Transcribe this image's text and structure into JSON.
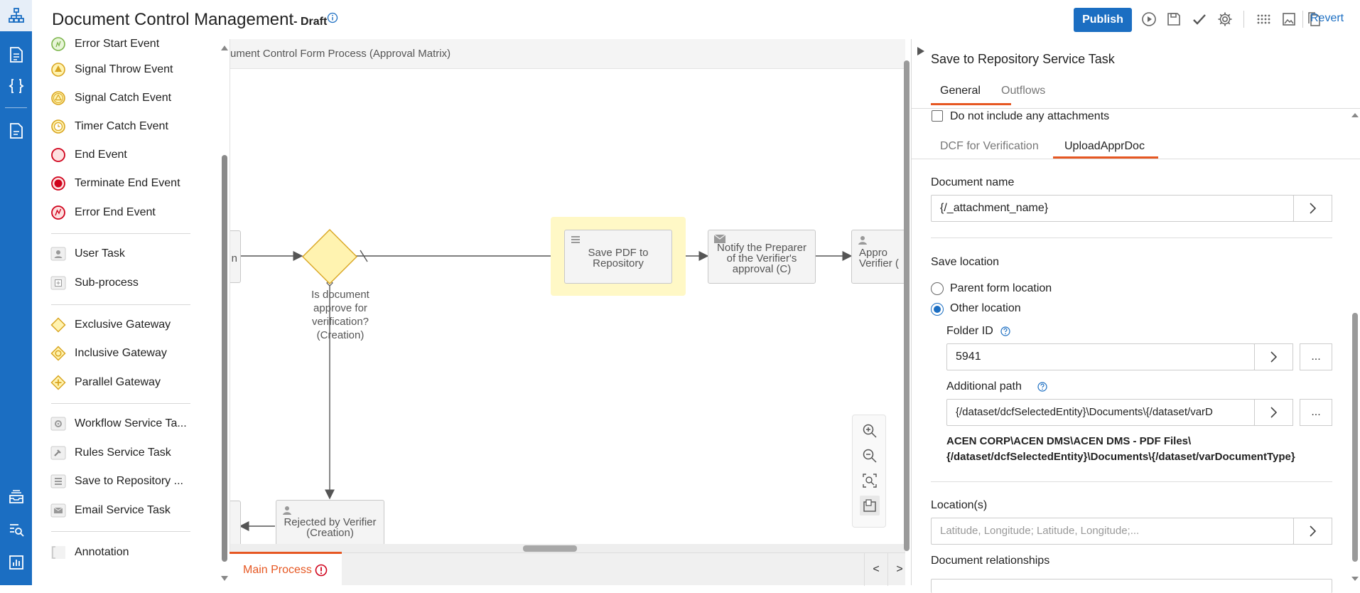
{
  "app": {
    "title": "Document Control Management",
    "status": "- Draft"
  },
  "toolbar": {
    "publish_label": "Publish",
    "revert_label": "Revert"
  },
  "palette": {
    "events": [
      {
        "label": "Error Start Event",
        "icon": "error-start-event-icon"
      },
      {
        "label": "Signal Throw Event",
        "icon": "signal-throw-event-icon"
      },
      {
        "label": "Signal Catch Event",
        "icon": "signal-catch-event-icon"
      },
      {
        "label": "Timer Catch Event",
        "icon": "timer-catch-event-icon"
      },
      {
        "label": "End Event",
        "icon": "end-event-icon"
      },
      {
        "label": "Terminate End Event",
        "icon": "terminate-end-event-icon"
      },
      {
        "label": "Error End Event",
        "icon": "error-end-event-icon"
      }
    ],
    "tasks": [
      {
        "label": "User Task",
        "icon": "user-task-icon"
      },
      {
        "label": "Sub-process",
        "icon": "sub-process-icon"
      }
    ],
    "gateways": [
      {
        "label": "Exclusive Gateway",
        "icon": "exclusive-gateway-icon"
      },
      {
        "label": "Inclusive Gateway",
        "icon": "inclusive-gateway-icon"
      },
      {
        "label": "Parallel Gateway",
        "icon": "parallel-gateway-icon"
      }
    ],
    "services": [
      {
        "label": "Workflow Service Ta...",
        "icon": "gear-icon"
      },
      {
        "label": "Rules Service Task",
        "icon": "gavel-icon"
      },
      {
        "label": "Save to Repository ...",
        "icon": "repository-icon"
      },
      {
        "label": "Email Service Task",
        "icon": "envelope-icon"
      }
    ],
    "annotation": {
      "label": "Annotation",
      "icon": "annotation-icon"
    }
  },
  "canvas": {
    "title": "ument Control Form Process (Approval Matrix)",
    "left_task_fragment": "n",
    "gateway_label": "Is document approve for verification? (Creation)",
    "task_save_pdf": "Save PDF to Repository",
    "task_notify": "Notify the Preparer of the Verifier's approval (C)",
    "task_approve": "Appro Verifier (",
    "task_rejected": "Rejected by Verifier (Creation)"
  },
  "bottom_tabs": {
    "main_tab": "Main Process",
    "prev": "<",
    "next": ">"
  },
  "panel": {
    "title": "Save to Repository Service Task",
    "tabs": [
      "General",
      "Outflows"
    ],
    "active_tab": "General",
    "no_attachments_label": "Do not include any attachments",
    "no_attachments_checked": false,
    "sub_tabs": [
      "DCF for Verification",
      "UploadApprDoc"
    ],
    "active_sub_tab": "UploadApprDoc",
    "document_name_label": "Document name",
    "document_name_value": "{/_attachment_name}",
    "save_location_label": "Save location",
    "save_location_options": [
      "Parent form location",
      "Other location"
    ],
    "save_location_selected": "Other location",
    "folder_id_label": "Folder ID",
    "folder_id_value": "5941",
    "additional_path_label": "Additional path",
    "additional_path_value": "{/dataset/dcfSelectedEntity}\\Documents\\{/dataset/varD",
    "resolved_path_line1": "ACEN CORP\\ACEN DMS\\ACEN DMS - PDF Files\\",
    "resolved_path_line2": "{/dataset/dcfSelectedEntity}\\Documents\\{/dataset/varDocumentType}",
    "locations_label": "Location(s)",
    "locations_placeholder": "Latitude, Longitude; Latitude, Longitude;...",
    "relationships_label": "Document relationships",
    "browse_label": "...",
    "chevron": ">"
  },
  "colors": {
    "brand_blue": "#1b6ec2",
    "accent_orange": "#e65722",
    "highlight_yellow": "#fff8c6",
    "gateway_yellow": "#fff3b0",
    "end_event_red": "#d0021b"
  }
}
